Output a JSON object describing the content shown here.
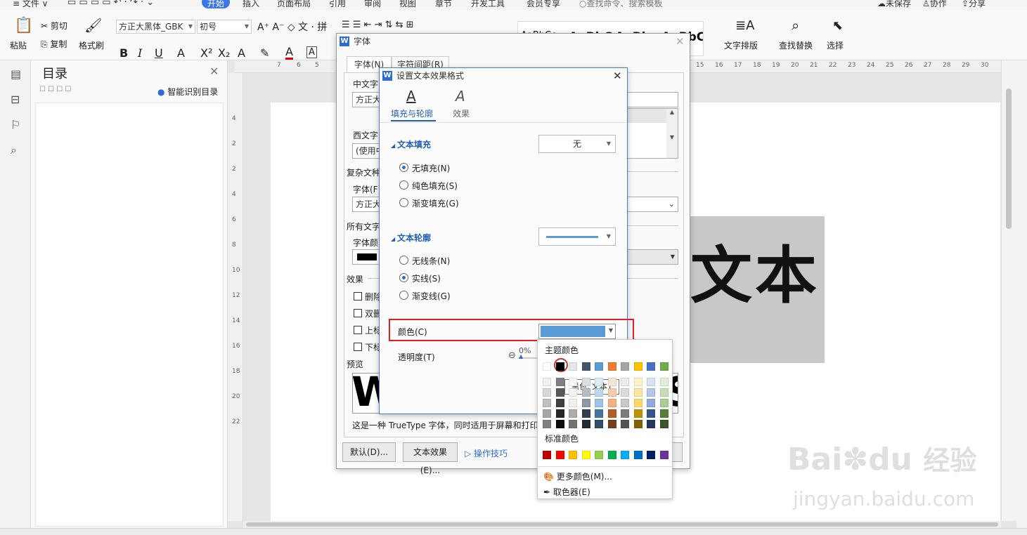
{
  "menubar": {
    "file": "≡ 文件 ∨",
    "tabs": [
      "开始",
      "插入",
      "页面布局",
      "引用",
      "审阅",
      "视图",
      "章节",
      "开发工具",
      "会员专享"
    ],
    "search": "查找命令、搜索模板",
    "unsaved": "未保存",
    "collab": "协作",
    "share": "分享"
  },
  "ribbon": {
    "paste": "粘贴",
    "cut": "剪切",
    "copy": "复制",
    "format_painter": "格式刷",
    "font_name": "方正大黑体_GBK",
    "font_size": "初号",
    "styles": [
      "AaBbCc",
      "AaBbC",
      "AaBb",
      "AaBbC"
    ],
    "text_layout": "文字排版",
    "find_replace": "查找替换",
    "select": "选择"
  },
  "toc": {
    "title": "目录",
    "smart": "智能识别目录"
  },
  "ruler": {
    "h_ticks": [
      "7",
      "6",
      "5",
      "15",
      "16",
      "17",
      "18",
      "19",
      "20",
      "21",
      "22",
      "23",
      "24",
      "25",
      "26",
      "27",
      "28",
      "29",
      "30"
    ],
    "v_ticks": [
      "4",
      "2",
      "2",
      "4",
      "6",
      "8",
      "10",
      "12",
      "14",
      "16",
      "18",
      "20",
      "22"
    ]
  },
  "document": {
    "big_text": "文本"
  },
  "font_dialog": {
    "title": "字体",
    "tab_font": "字体(N)",
    "tab_spacing": "字符间距(R)",
    "cn_font_label": "中文字",
    "cn_font_value": "方正大",
    "west_font_label": "西文字",
    "west_font_value": "(使用中",
    "complex_label": "复杂文种",
    "complex_font_label": "字体(F)",
    "complex_font_value": "方正大",
    "all_text_label": "所有文字",
    "font_color_label": "字体颜",
    "effects_label": "效果",
    "effects": [
      "删除",
      "双删",
      "上标",
      "下标"
    ],
    "preview_label": "预览",
    "preview_text_left": "W",
    "preview_text_right": "S",
    "note": "这是一种 TrueType 字体，同时适用于屏幕和打印",
    "default_btn": "默认(D)...",
    "text_effect_btn": "文本效果(E)...",
    "tips": "操作技巧"
  },
  "effect_dialog": {
    "title": "设置文本效果格式",
    "tab_fill": "填充与轮廓",
    "tab_effect": "效果",
    "text_fill": "文本填充",
    "fill_value": "无",
    "fill_options": [
      "无填充(N)",
      "纯色填充(S)",
      "渐变填充(G)"
    ],
    "text_outline": "文本轮廓",
    "outline_options": [
      "无线条(N)",
      "实线(S)",
      "渐变线(G)"
    ],
    "color_label": "颜色(C)",
    "transparency_label": "透明度(T)",
    "transparency_value": "0%",
    "accent_color": "#5b9bd5",
    "highlight_color": "#e02020"
  },
  "palette": {
    "theme_title": "主题颜色",
    "standard_title": "标准颜色",
    "tooltip": "黑色, 文本1",
    "more_colors": "更多颜色(M)...",
    "picker": "取色器(E)",
    "theme_row": [
      "#ffffff",
      "#000000",
      "#e7e6e6",
      "#44546a",
      "#5b9bd5",
      "#ed7d31",
      "#a5a5a5",
      "#ffc000",
      "#4472c4",
      "#70ad47"
    ],
    "standard_row": [
      "#c00000",
      "#ff0000",
      "#ffc000",
      "#ffff00",
      "#92d050",
      "#00b050",
      "#00b0f0",
      "#0070c0",
      "#002060",
      "#7030a0"
    ]
  },
  "watermark": {
    "brand": "Bai",
    "brand2": "du",
    "jingyan": "经验",
    "url": "jingyan.baidu.com"
  }
}
